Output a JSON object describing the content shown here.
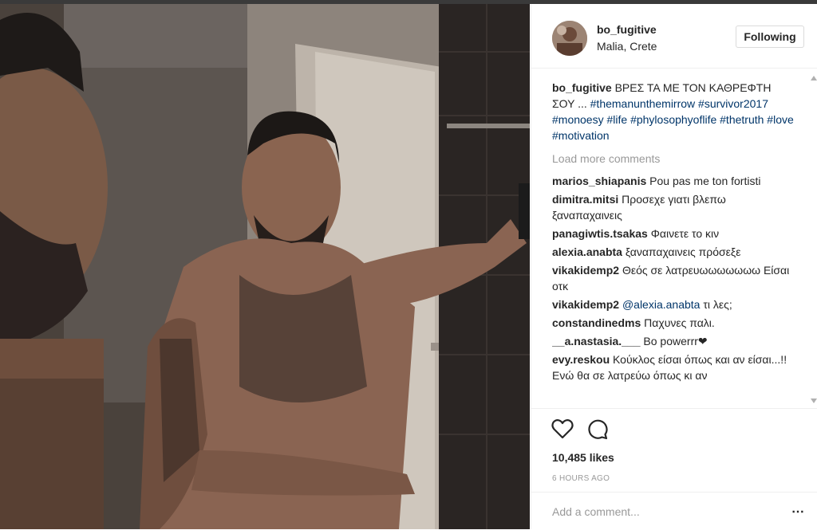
{
  "post": {
    "username": "bo_fugitive",
    "location": "Malia, Crete",
    "follow_label": "Following",
    "caption": {
      "user": "bo_fugitive",
      "text": "ΒΡΕΣ ΤΑ ΜΕ ΤΟΝ ΚΑΘΡΕΦΤΗ ΣΟΥ ...",
      "hashtags": [
        "#themanunthemirrow",
        "#survivor2017",
        "#monoesy",
        "#life",
        "#phylosophyoflife",
        "#thetruth",
        "#love",
        "#motivation"
      ]
    },
    "load_more": "Load more comments",
    "comments": [
      {
        "user": "marios_shiapanis",
        "text": "Pou pas me ton fortisti"
      },
      {
        "user": "dimitra.mitsi",
        "text": "Προσεχε γιατι βλεπω ξαναπαχαινεις"
      },
      {
        "user": "panagiwtis.tsakas",
        "text": "Φαινετε το κιν"
      },
      {
        "user": "alexia.anabta",
        "text": "ξαναπαχαινεις πρόσεξε"
      },
      {
        "user": "vikakidemp2",
        "text": "Θεός σε λατρευωωωωωωω Είσαι οτκ"
      },
      {
        "user": "vikakidemp2",
        "mention": "@alexia.anabta",
        "text": "τι λες;"
      },
      {
        "user": "constandinedms",
        "text": "Παχυνες παλι."
      },
      {
        "user": "__a.nastasia.___",
        "text": "Bo powerrr❤"
      },
      {
        "user": "evy.reskou",
        "text": "Κούκλος είσαι όπως και αν είσαι...!! Ενώ θα σε λατρεύω όπως κι αν"
      }
    ],
    "likes": "10,485 likes",
    "time": "6 HOURS AGO",
    "add_comment_placeholder": "Add a comment...",
    "more_icon": "⋯",
    "icons": {
      "like": "heart-icon",
      "comment": "comment-bubble-icon",
      "options": "more-options-icon"
    }
  }
}
